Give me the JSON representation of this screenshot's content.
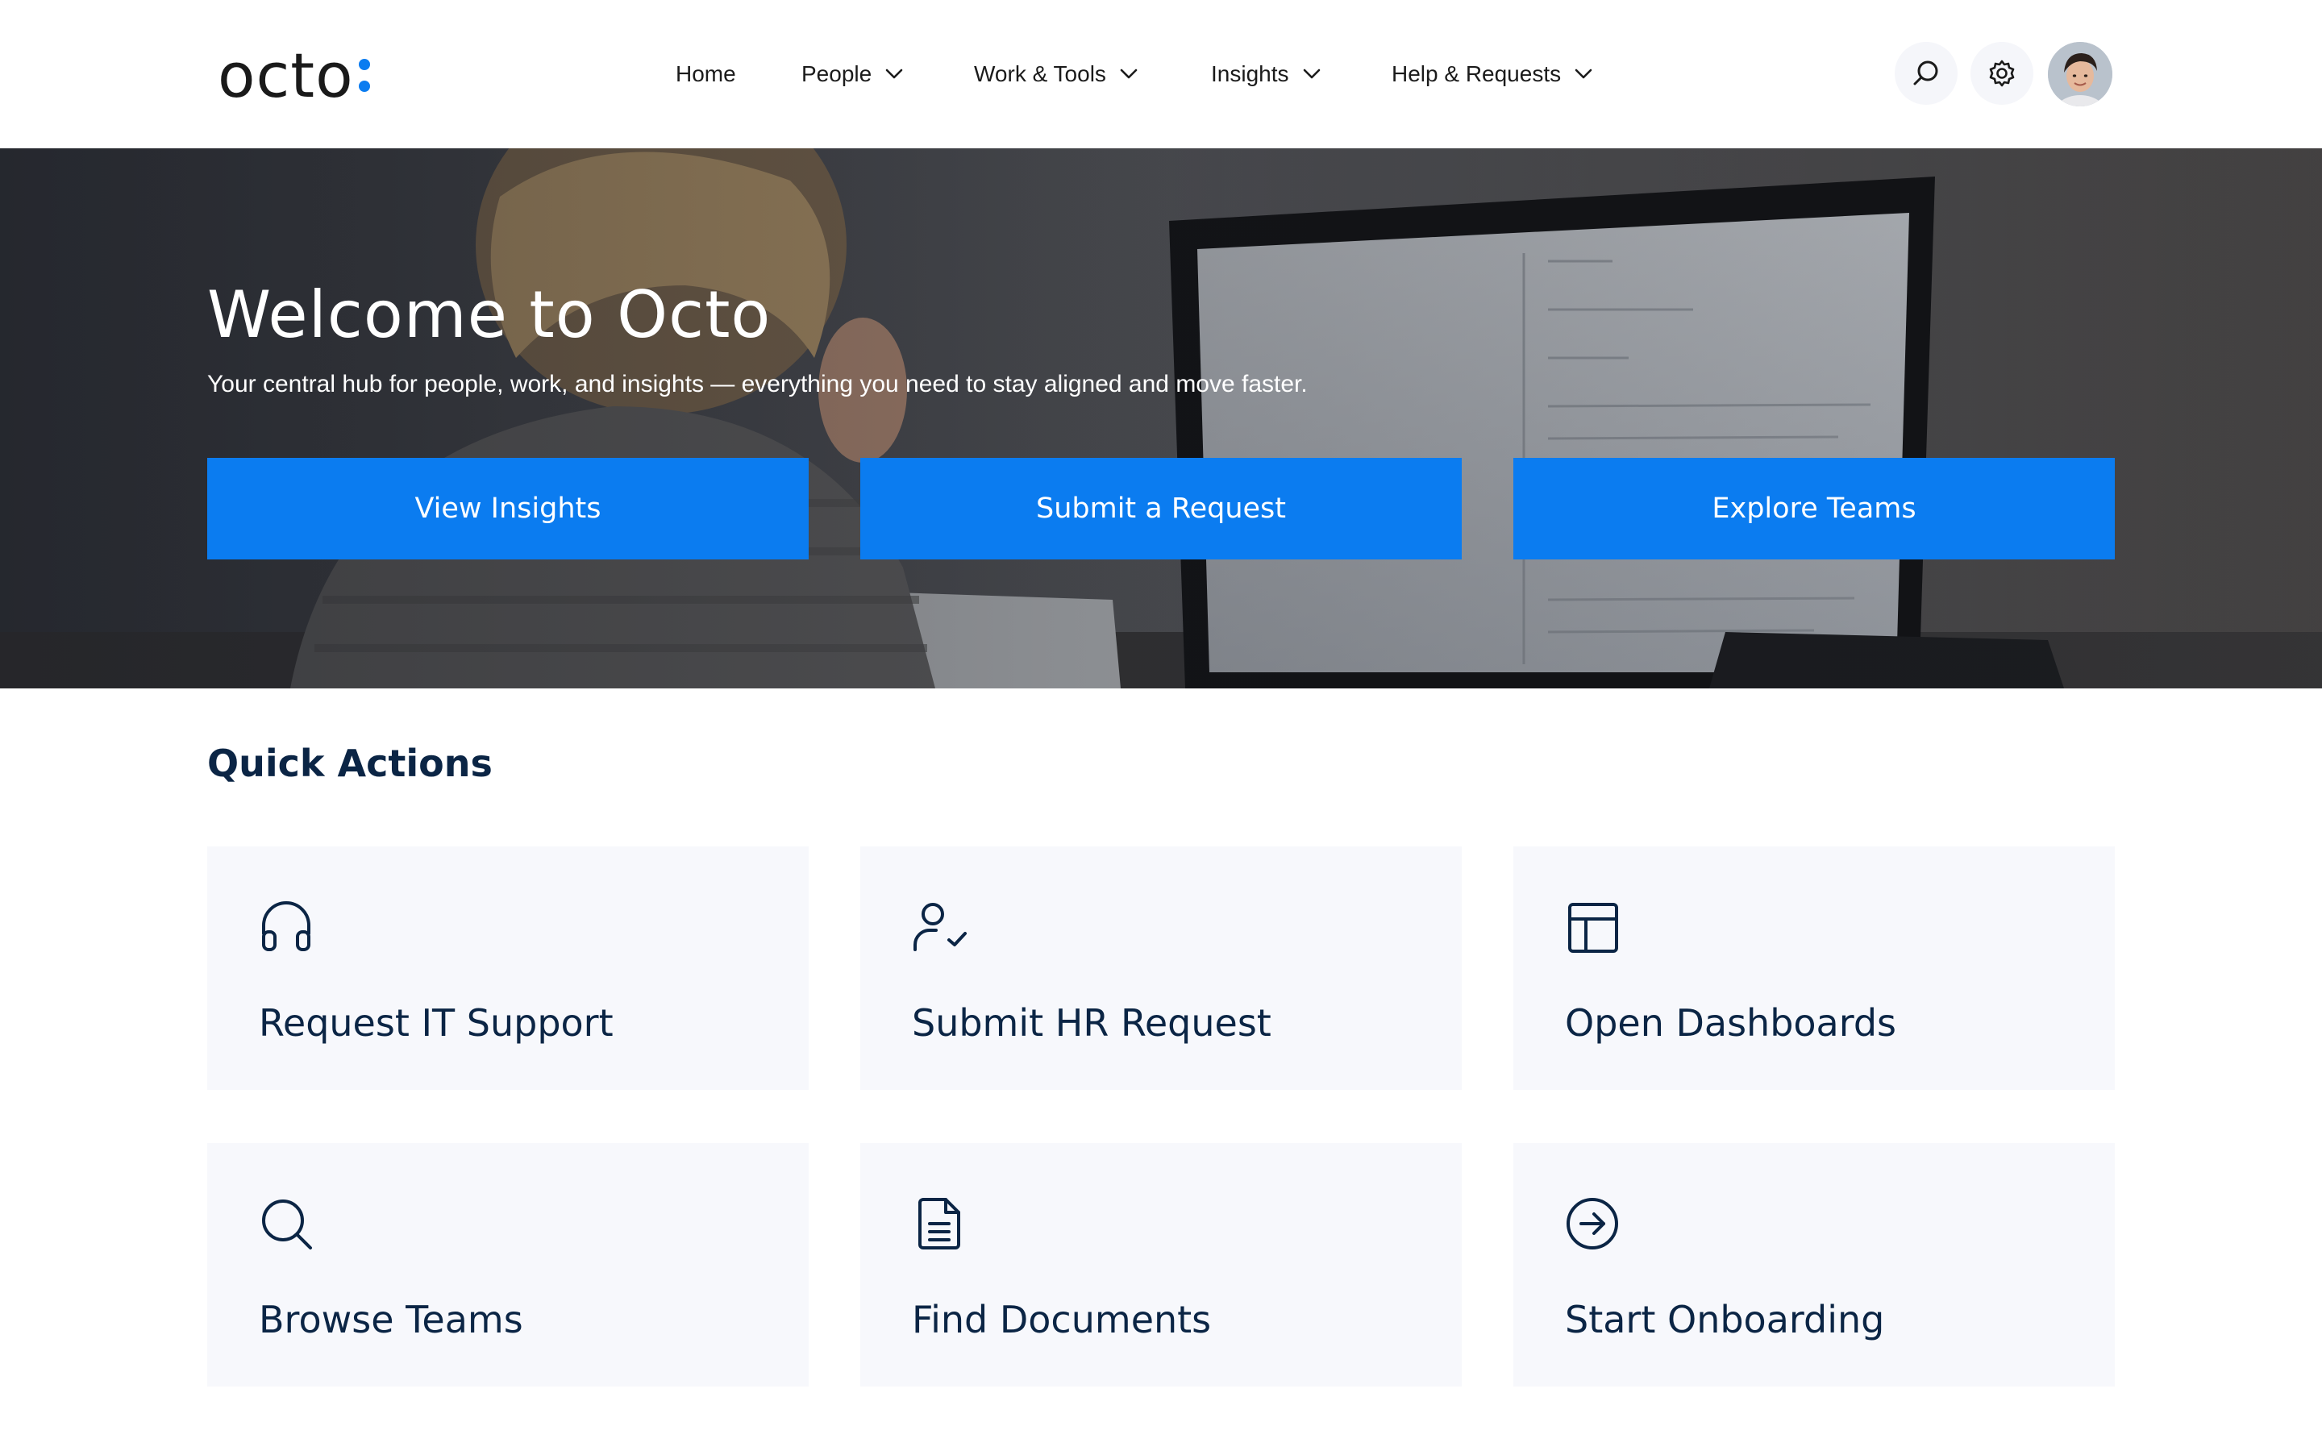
{
  "brand": {
    "logo_text": "octo",
    "accent": "#0b7cf0",
    "navy": "#0b2545"
  },
  "nav": {
    "items": [
      {
        "label": "Home",
        "dropdown": false
      },
      {
        "label": "People",
        "dropdown": true
      },
      {
        "label": "Work & Tools",
        "dropdown": true
      },
      {
        "label": "Insights",
        "dropdown": true
      },
      {
        "label": "Help & Requests",
        "dropdown": true
      }
    ]
  },
  "header_actions": {
    "search_icon": "search-icon",
    "settings_icon": "gear-icon",
    "avatar": "user-avatar"
  },
  "hero": {
    "title": "Welcome to Octo",
    "subtitle": "Your central hub for people, work, and insights — everything you need to stay aligned and move faster.",
    "buttons": [
      "View Insights",
      "Submit a Request",
      "Explore Teams"
    ]
  },
  "quick_actions": {
    "title": "Quick Actions",
    "cards": [
      {
        "label": "Request IT Support",
        "icon": "headphones-icon"
      },
      {
        "label": "Submit HR Request",
        "icon": "user-check-icon"
      },
      {
        "label": "Open Dashboards",
        "icon": "layout-icon"
      },
      {
        "label": "Browse Teams",
        "icon": "search-icon"
      },
      {
        "label": "Find Documents",
        "icon": "document-icon"
      },
      {
        "label": "Start Onboarding",
        "icon": "arrow-circle-right-icon"
      }
    ]
  }
}
